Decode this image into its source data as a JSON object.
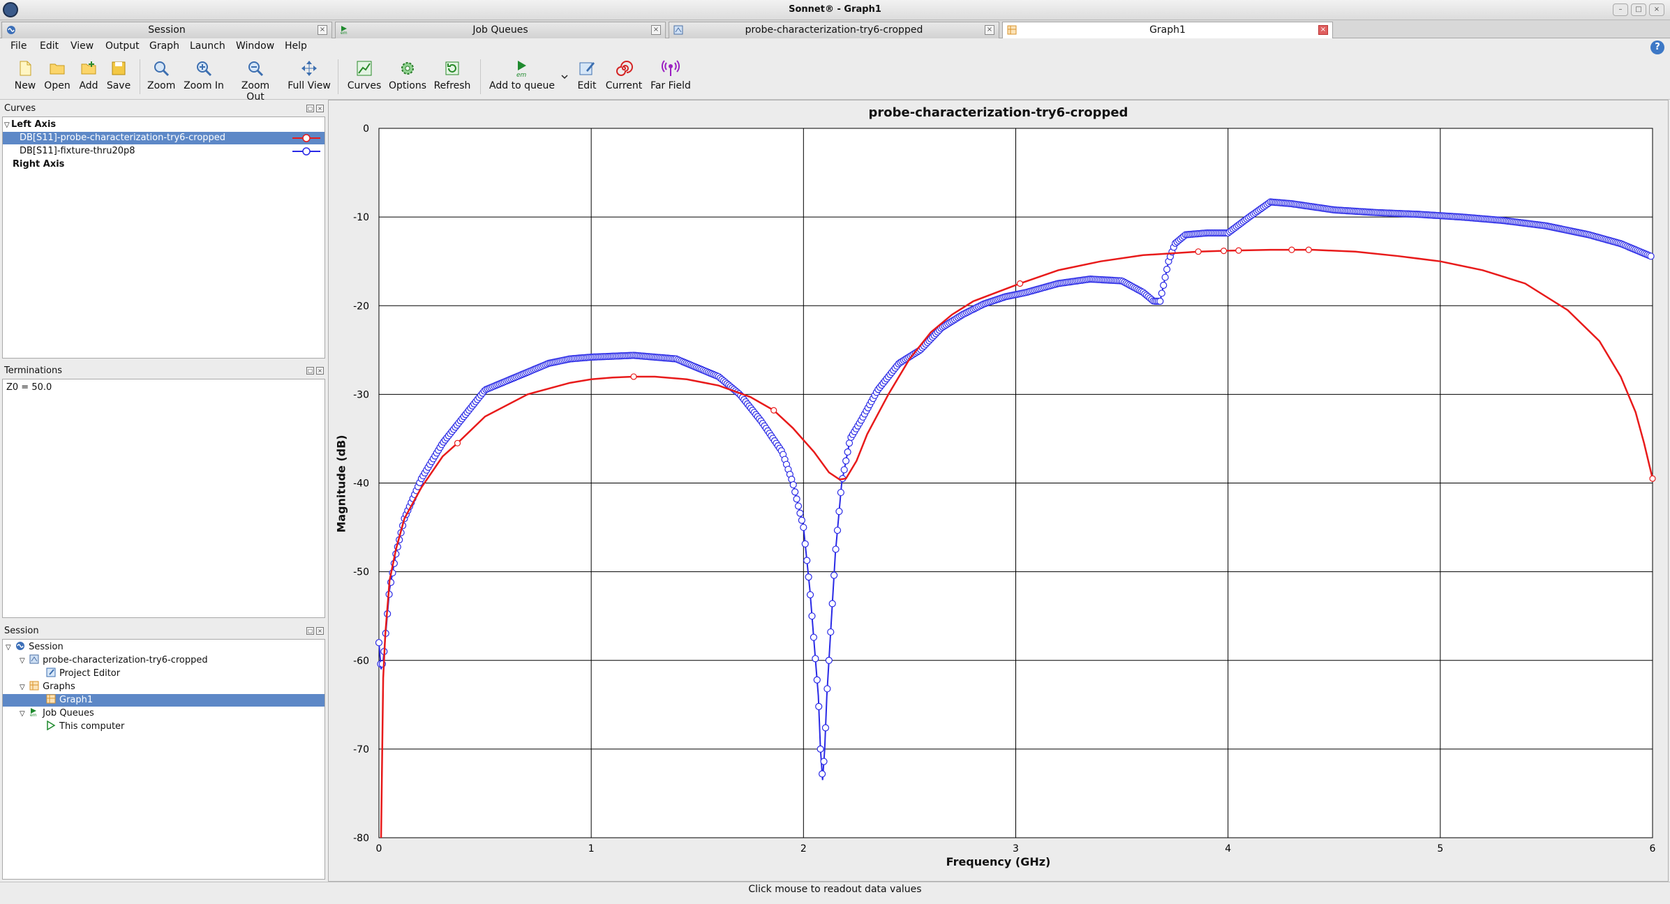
{
  "window": {
    "title": "Sonnet® - Graph1"
  },
  "tabs": [
    {
      "label": "Session",
      "icon": "session-icon",
      "active": false
    },
    {
      "label": "Job Queues",
      "icon": "em-icon",
      "active": false
    },
    {
      "label": "probe-characterization-try6-cropped",
      "icon": "project-icon",
      "active": false
    },
    {
      "label": "Graph1",
      "icon": "graph-icon",
      "active": true
    }
  ],
  "menu": [
    {
      "label": "File",
      "key": "F"
    },
    {
      "label": "Edit",
      "key": "E"
    },
    {
      "label": "View",
      "key": "V"
    },
    {
      "label": "Output",
      "key": "O"
    },
    {
      "label": "Graph",
      "key": "G"
    },
    {
      "label": "Launch",
      "key": "L"
    },
    {
      "label": "Window",
      "key": "W"
    },
    {
      "label": "Help",
      "key": "H"
    }
  ],
  "toolbar": {
    "new": "New",
    "open": "Open",
    "add": "Add",
    "save": "Save",
    "zoom": "Zoom",
    "zoom_in": "Zoom In",
    "zoom_out": "Zoom Out",
    "full_view": "Full View",
    "curves": "Curves",
    "options": "Options",
    "refresh": "Refresh",
    "add_to_queue": "Add to queue",
    "edit": "Edit",
    "current": "Current",
    "far_field": "Far Field"
  },
  "curves_panel": {
    "title": "Curves",
    "left_axis": "Left Axis",
    "right_axis": "Right Axis",
    "items": [
      {
        "label": "DB[S11]-probe-characterization-try6-cropped",
        "color": "#e81b1b",
        "selected": true
      },
      {
        "label": "DB[S11]-fixture-thru20p8",
        "color": "#2a2ae6",
        "selected": false
      }
    ]
  },
  "terminations_panel": {
    "title": "Terminations",
    "value": "Z0 = 50.0"
  },
  "session_panel": {
    "title": "Session",
    "tree": {
      "session": "Session",
      "project": "probe-characterization-try6-cropped",
      "project_editor": "Project Editor",
      "graphs": "Graphs",
      "graph1": "Graph1",
      "job_queues": "Job Queues",
      "this_computer": "This computer"
    }
  },
  "status": {
    "text": "Click mouse to readout data values"
  },
  "chart_data": {
    "type": "line",
    "title": "probe-characterization-try6-cropped",
    "xlabel": "Frequency (GHz)",
    "ylabel": "Magnitude (dB)",
    "xlim": [
      0,
      6
    ],
    "ylim": [
      -80,
      0
    ],
    "x_ticks": [
      0,
      1,
      2,
      3,
      4,
      5,
      6
    ],
    "y_ticks": [
      0,
      -10,
      -20,
      -30,
      -40,
      -50,
      -60,
      -70,
      -80
    ],
    "grid": true,
    "series": [
      {
        "name": "DB[S11]-probe-characterization-try6-cropped",
        "color": "#e81b1b",
        "marker": "sparse-circle",
        "x": [
          0.01,
          0.02,
          0.03,
          0.05,
          0.08,
          0.12,
          0.2,
          0.3,
          0.37,
          0.5,
          0.7,
          0.9,
          1.0,
          1.1,
          1.2,
          1.3,
          1.45,
          1.6,
          1.75,
          1.86,
          1.95,
          2.05,
          2.12,
          2.17,
          2.2,
          2.25,
          2.3,
          2.4,
          2.5,
          2.6,
          2.7,
          2.8,
          3.02,
          3.2,
          3.4,
          3.6,
          3.86,
          4.0,
          4.2,
          4.4,
          4.6,
          4.8,
          5.0,
          5.2,
          5.4,
          5.6,
          5.75,
          5.85,
          5.92,
          5.96,
          6.0
        ],
        "y": [
          -80,
          -62,
          -57,
          -51,
          -47.5,
          -44,
          -40.5,
          -37,
          -35.5,
          -32.5,
          -30,
          -28.7,
          -28.3,
          -28.1,
          -28.0,
          -28.0,
          -28.3,
          -29.0,
          -30.3,
          -31.8,
          -33.8,
          -36.5,
          -38.8,
          -39.6,
          -39.5,
          -37.5,
          -34.5,
          -30.0,
          -26.0,
          -23.0,
          -21.0,
          -19.5,
          -17.5,
          -16.0,
          -15.0,
          -14.3,
          -13.9,
          -13.8,
          -13.7,
          -13.7,
          -13.9,
          -14.4,
          -15.0,
          -16.0,
          -17.5,
          -20.5,
          -24.0,
          -28.0,
          -32.0,
          -35.5,
          -39.5
        ],
        "marker_x": [
          0.37,
          1.2,
          1.86,
          3.02,
          3.86,
          3.98,
          4.05,
          4.3,
          4.38,
          6.0
        ]
      },
      {
        "name": "DB[S11]-fixture-thru20p8",
        "color": "#2a2ae6",
        "marker": "dense-circle",
        "x": [
          0.0,
          0.01,
          0.02,
          0.03,
          0.05,
          0.08,
          0.12,
          0.2,
          0.3,
          0.4,
          0.5,
          0.6,
          0.7,
          0.8,
          0.9,
          1.0,
          1.1,
          1.2,
          1.3,
          1.4,
          1.5,
          1.6,
          1.7,
          1.8,
          1.9,
          1.95,
          2.0,
          2.03,
          2.05,
          2.07,
          2.08,
          2.09,
          2.1,
          2.11,
          2.13,
          2.15,
          2.18,
          2.22,
          2.27,
          2.35,
          2.45,
          2.55,
          2.65,
          2.75,
          2.85,
          2.95,
          3.05,
          3.2,
          3.35,
          3.5,
          3.6,
          3.65,
          3.68,
          3.72,
          3.75,
          3.8,
          3.9,
          4.0,
          4.1,
          4.2,
          4.3,
          4.5,
          4.7,
          4.9,
          5.1,
          5.3,
          5.5,
          5.7,
          5.85,
          6.0
        ],
        "y": [
          -58,
          -61,
          -60,
          -57.5,
          -52,
          -48,
          -44,
          -39.5,
          -35.5,
          -32.5,
          -29.5,
          -28.5,
          -27.5,
          -26.5,
          -26.0,
          -25.8,
          -25.7,
          -25.6,
          -25.8,
          -26.0,
          -27.0,
          -28.0,
          -30.0,
          -33.0,
          -36.5,
          -40.0,
          -45.0,
          -52.0,
          -58.0,
          -64.0,
          -70.0,
          -73.5,
          -70.0,
          -64.0,
          -56.0,
          -48.0,
          -40.0,
          -35.0,
          -33.0,
          -29.5,
          -26.5,
          -25.0,
          -22.5,
          -21.0,
          -19.8,
          -19.0,
          -18.5,
          -17.5,
          -17.0,
          -17.2,
          -18.5,
          -19.5,
          -19.5,
          -15.0,
          -13.0,
          -12.0,
          -11.8,
          -11.8,
          -10.0,
          -8.3,
          -8.5,
          -9.2,
          -9.5,
          -9.7,
          -10.0,
          -10.4,
          -11.0,
          -12.0,
          -13.0,
          -14.5
        ]
      }
    ]
  }
}
